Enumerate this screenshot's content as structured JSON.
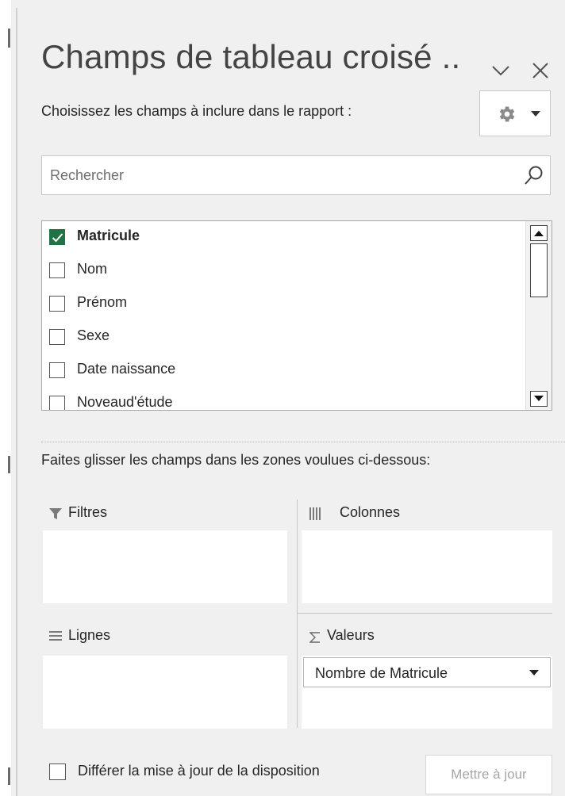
{
  "panel": {
    "title": "Champs de tableau croisé ..",
    "subtitle": "Choisissez les champs à inclure dans le rapport :",
    "icons": {
      "collapse": "chevron-down-icon",
      "close": "close-icon",
      "tools": "gear-icon"
    }
  },
  "search": {
    "placeholder": "Rechercher",
    "value": ""
  },
  "fields": [
    {
      "label": "Matricule",
      "checked": true
    },
    {
      "label": "Nom",
      "checked": false
    },
    {
      "label": "Prénom",
      "checked": false
    },
    {
      "label": "Sexe",
      "checked": false
    },
    {
      "label": "Date naissance",
      "checked": false
    },
    {
      "label": "Noveaud'étude",
      "checked": false
    }
  ],
  "areas": {
    "instruction": "Faites glisser les champs dans les zones voulues ci-dessous:",
    "filters": {
      "label": "Filtres",
      "icon": "filter-icon"
    },
    "columns": {
      "label": "Colonnes",
      "icon": "columns-icon"
    },
    "rows": {
      "label": "Lignes",
      "icon": "rows-icon"
    },
    "values": {
      "label": "Valeurs",
      "icon": "sigma-icon",
      "items": [
        "Nombre de Matricule"
      ]
    }
  },
  "footer": {
    "defer_label": "Différer la mise à jour de la disposition",
    "defer_checked": false,
    "update_label": "Mettre à jour"
  },
  "colors": {
    "accent": "#217346",
    "panel_bg": "#f0f0f0",
    "border": "#c8c8c8"
  }
}
